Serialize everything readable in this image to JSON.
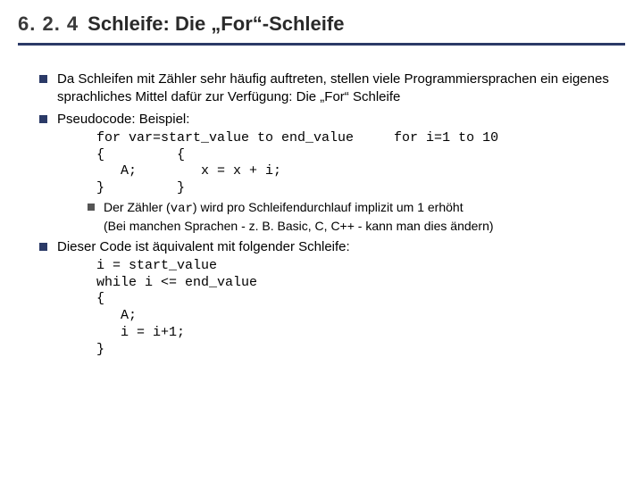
{
  "title": {
    "num": "6. 2. 4",
    "text": "Schleife: Die „For“-Schleife"
  },
  "bullets": {
    "b1": "Da Schleifen mit Zähler sehr häufig auftreten, stellen viele Programmiersprachen ein eigenes sprachliches Mittel dafür zur Verfügung: Die „For“ Schleife",
    "b2": "Pseudocode:  Beispiel:",
    "code1": "for var=start_value to end_value     for i=1 to 10\n{         {\n   A;        x = x + i;\n}         }",
    "sub1_pre": "Der Zähler (",
    "sub1_var": "var",
    "sub1_post": ") wird pro Schleifendurchlauf implizit um 1 erhöht\n(Bei manchen Sprachen - z. B. Basic, C, C++ - kann man dies ändern)",
    "b3": "Dieser Code ist äquivalent mit folgender Schleife:",
    "code2": "i = start_value\nwhile i <= end_value\n{\n   A;\n   i = i+1;\n}"
  }
}
